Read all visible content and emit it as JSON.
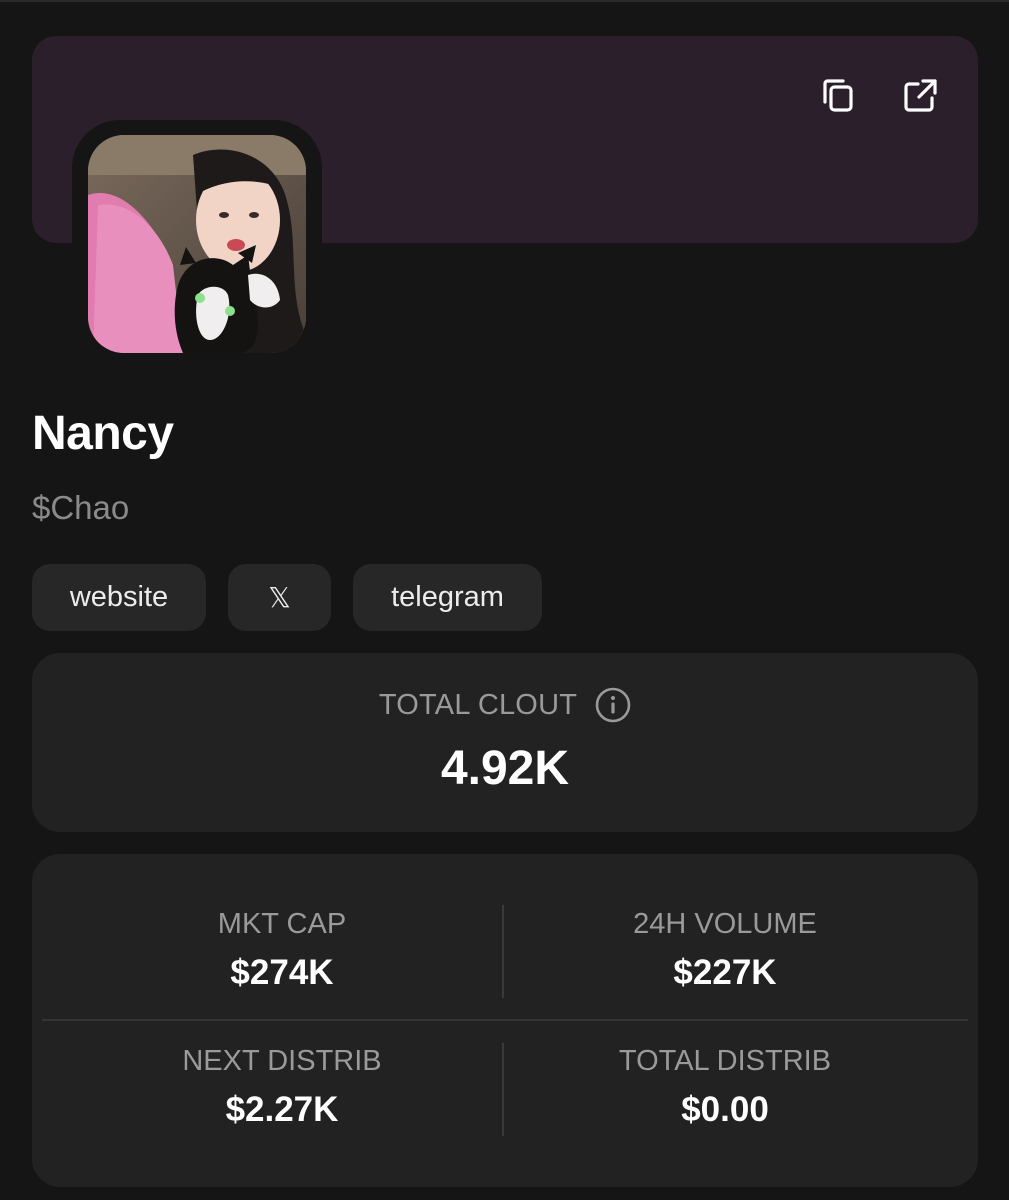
{
  "profile": {
    "name": "Nancy",
    "ticker": "$Chao"
  },
  "links": {
    "website": "website",
    "x": "𝕏",
    "telegram": "telegram"
  },
  "clout": {
    "label": "TOTAL CLOUT",
    "value": "4.92K"
  },
  "stats": {
    "mkt_cap": {
      "label": "MKT CAP",
      "value": "$274K"
    },
    "volume_24h": {
      "label": "24H VOLUME",
      "value": "$227K"
    },
    "next_distrib": {
      "label": "NEXT DISTRIB",
      "value": "$2.27K"
    },
    "total_distrib": {
      "label": "TOTAL DISTRIB",
      "value": "$0.00"
    }
  },
  "icons": {
    "copy": "copy-icon",
    "external": "external-link-icon",
    "info": "info-icon"
  },
  "colors": {
    "background": "#151515",
    "banner": "#2a1f2b",
    "card": "#222222",
    "pill": "#272727",
    "muted_text": "#9a9a9a"
  }
}
